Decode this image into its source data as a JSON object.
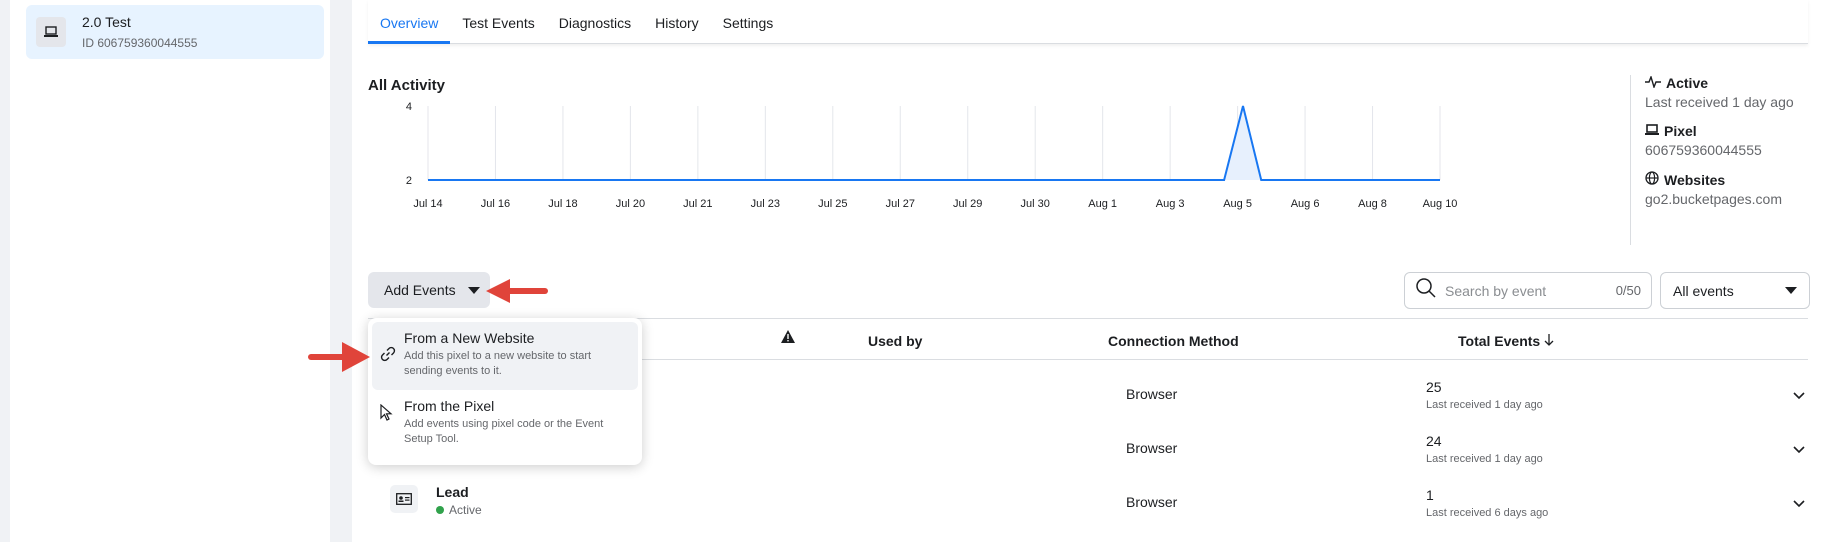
{
  "sidebar": {
    "pixel_name": "2.0 Test",
    "pixel_id": "ID 606759360044555"
  },
  "tabs": [
    "Overview",
    "Test Events",
    "Diagnostics",
    "History",
    "Settings"
  ],
  "activity": {
    "title": "All Activity"
  },
  "chart_data": {
    "type": "area",
    "title": "All Activity",
    "categories": [
      "Jul 14",
      "Jul 16",
      "Jul 18",
      "Jul 20",
      "Jul 21",
      "Jul 23",
      "Jul 25",
      "Jul 27",
      "Jul 29",
      "Jul 30",
      "Aug 1",
      "Aug 3",
      "Aug 5",
      "Aug 6",
      "Aug 8",
      "Aug 10"
    ],
    "y_ticks": [
      "4",
      "2"
    ],
    "series": [
      {
        "points": [
          {
            "x": 0,
            "y": 2
          },
          {
            "x": 11.8,
            "y": 2
          },
          {
            "x": 12.08,
            "y": 4
          },
          {
            "x": 12.35,
            "y": 2
          },
          {
            "x": 15,
            "y": 2
          }
        ]
      }
    ],
    "ylim": [
      2,
      4
    ],
    "grid": true,
    "colors": {
      "line": "#1877f2",
      "fill": "#e7f0fd"
    }
  },
  "stats": {
    "active_label": "Active",
    "active_value": "Last received 1 day ago",
    "pixel_label": "Pixel",
    "pixel_value": "606759360044555",
    "websites_label": "Websites",
    "websites_value": "go2.bucketpages.com"
  },
  "toolbar": {
    "add_events_label": "Add Events",
    "search_placeholder": "Search by event",
    "search_count": "0/50",
    "filter_value": "All events"
  },
  "table": {
    "headers": {
      "used_by": "Used by",
      "connection_method": "Connection Method",
      "total_events": "Total Events"
    },
    "rows": [
      {
        "name": "",
        "status": "",
        "method": "Browser",
        "total": "25",
        "last": "Last received 1 day ago"
      },
      {
        "name": "",
        "status": "",
        "method": "Browser",
        "total": "24",
        "last": "Last received 1 day ago"
      },
      {
        "name": "Lead",
        "status": "Active",
        "method": "Browser",
        "total": "1",
        "last": "Last received 6 days ago"
      }
    ]
  },
  "dropdown": {
    "items": [
      {
        "title": "From a New Website",
        "desc": "Add this pixel to a new website to start sending events to it."
      },
      {
        "title": "From the Pixel",
        "desc": "Add events using pixel code or the Event Setup Tool."
      }
    ]
  },
  "colors": {
    "accent": "#1877f2",
    "annotation_arrow": "#e0443a",
    "status_active": "#31a24c"
  }
}
